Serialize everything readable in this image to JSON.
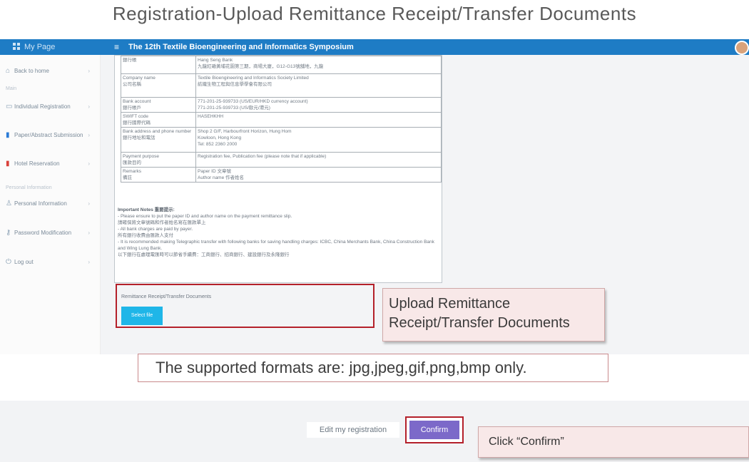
{
  "slide_title": "Registration-Upload Remittance Receipt/Transfer Documents",
  "topbar": {
    "brand": "My Page",
    "menu_icon": "menu-icon",
    "title": "The 12th Textile Bioengineering and Informatics Symposium"
  },
  "sidebar": {
    "back": "Back to home",
    "section_main": "Main",
    "items": [
      {
        "label": "Individual Registration",
        "icon": "id-card-icon"
      },
      {
        "label": "Paper/Abstract Submission",
        "icon": "file-icon"
      },
      {
        "label": "Hotel Reservation",
        "icon": "bookmark-icon"
      }
    ],
    "section_personal": "Personal Information",
    "personal_items": [
      {
        "label": "Personal Information",
        "icon": "user-icon"
      },
      {
        "label": "Password Modification",
        "icon": "key-icon"
      },
      {
        "label": "Log out",
        "icon": "power-icon"
      }
    ]
  },
  "remittance_table": {
    "rows": [
      {
        "label": "銀行帳",
        "value": "Hang Seng Bank\n九龍紅磡黃埔花園第三期，商場大廈，G12-G13號舖地，九龍"
      },
      {
        "label": "Company name\n公司名稱",
        "value": "Textile Bioengineering and Informatics Society Limited\n紡織生物工程與信息學學會有限公司"
      },
      {
        "label": "Bank account\n銀行帳戶",
        "value": "771-201-25-939733 (US/EUR/HKD currency account)\n771-201-25-939733 (US/歐元/港元)"
      },
      {
        "label": "SWIFT code\n銀行國際代碼",
        "value": "HASEHKHH"
      },
      {
        "label": "Bank address and phone number\n銀行地址和電話",
        "value": "Shop 2 G/F, Harbourfront Horizon, Hung Hom\nKowloon, Hong Kong\nTel: 852 2360 2000"
      },
      {
        "label": "Payment purpose\n匯款目的",
        "value": "Registration fee, Publication fee (please note that if applicable)"
      },
      {
        "label": "Remarks\n備註",
        "value": "Paper ID 文章號\nAuthor name 作者姓名"
      }
    ]
  },
  "notes": {
    "heading": "Important Notes 重要提示:",
    "lines": [
      "- Please ensure to put the paper ID and author name on the payment remittance slip.",
      "請確保將文章號碼和作者姓名寫在匯款單上",
      "- All bank charges are paid by payer.",
      "所有銀行收費由匯款人支付",
      "- It is recommended making Telegraphic transfer with following banks for saving handling charges: ICBC, China Merchants Bank, China Construction Bank and Wing Lung Bank.",
      "以下銀行在處理電匯時可以節省手續費：工商銀行、招商銀行、建設銀行及永隆銀行"
    ]
  },
  "upload": {
    "label": "Remittance Receipt/Transfer Documents",
    "button": "Select file"
  },
  "callout_upload": "Upload Remittance Receipt/Transfer Documents",
  "formats_note": "The supported formats are: jpg,jpeg,gif,png,bmp only.",
  "footer": {
    "edit": "Edit my registration",
    "confirm": "Confirm"
  },
  "callout_confirm": "Click “Confirm”",
  "colors": {
    "topbar": "#1e7cc5",
    "highlight_border": "#b4202a",
    "select_button": "#1fb6e8",
    "confirm_button": "#7c69c9",
    "callout_bg": "#f8e8e8"
  }
}
